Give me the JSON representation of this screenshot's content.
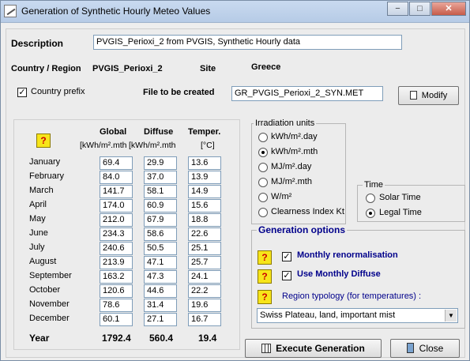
{
  "window": {
    "title": "Generation of Synthetic Hourly Meteo Values",
    "minimize": "−",
    "restore": "□",
    "close": "✕"
  },
  "description": {
    "label": "Description",
    "value": "PVGIS_Perioxi_2  from PVGIS, Synthetic Hourly data"
  },
  "location": {
    "country_region_label": "Country / Region",
    "country_region_value": "PVGIS_Perioxi_2",
    "site_label": "Site",
    "site_value": "Greece"
  },
  "country_prefix": {
    "label": "Country prefix",
    "checked": "✓"
  },
  "file": {
    "label": "File to be created",
    "value": "GR_PVGIS_Perioxi_2_SYN.MET",
    "modify_label": "Modify"
  },
  "table": {
    "year_header": "Year",
    "columns": [
      {
        "header": "Global",
        "unit": "[kWh/m².mth"
      },
      {
        "header": "Diffuse",
        "unit": "[kWh/m².mth"
      },
      {
        "header": "Temper.",
        "unit": "[°C]"
      }
    ],
    "rows": [
      {
        "month": "January",
        "global": "69.4",
        "diffuse": "29.9",
        "temp": "13.6"
      },
      {
        "month": "February",
        "global": "84.0",
        "diffuse": "37.0",
        "temp": "13.9"
      },
      {
        "month": "March",
        "global": "141.7",
        "diffuse": "58.1",
        "temp": "14.9"
      },
      {
        "month": "April",
        "global": "174.0",
        "diffuse": "60.9",
        "temp": "15.6"
      },
      {
        "month": "May",
        "global": "212.0",
        "diffuse": "67.9",
        "temp": "18.8"
      },
      {
        "month": "June",
        "global": "234.3",
        "diffuse": "58.6",
        "temp": "22.6"
      },
      {
        "month": "July",
        "global": "240.6",
        "diffuse": "50.5",
        "temp": "25.1"
      },
      {
        "month": "August",
        "global": "213.9",
        "diffuse": "47.1",
        "temp": "25.7"
      },
      {
        "month": "September",
        "global": "163.2",
        "diffuse": "47.3",
        "temp": "24.1"
      },
      {
        "month": "October",
        "global": "120.6",
        "diffuse": "44.6",
        "temp": "22.2"
      },
      {
        "month": "November",
        "global": "78.6",
        "diffuse": "31.4",
        "temp": "19.6"
      },
      {
        "month": "December",
        "global": "60.1",
        "diffuse": "27.1",
        "temp": "16.7"
      }
    ],
    "total": {
      "label": "Year",
      "global": "1792.4",
      "diffuse": "560.4",
      "temp": "19.4"
    }
  },
  "irradiation_units": {
    "title": "Irradiation units",
    "options": [
      "kWh/m².day",
      "kWh/m².mth",
      "MJ/m².day",
      "MJ/m².mth",
      "W/m²",
      "Clearness Index Kt"
    ],
    "selected": "kWh/m².mth"
  },
  "time": {
    "title": "Time",
    "options": [
      "Solar Time",
      "Legal Time"
    ],
    "selected": "Legal Time"
  },
  "generation_options": {
    "title": "Generation options",
    "monthly_renormalisation": "Monthly renormalisation",
    "use_monthly_diffuse": "Use Monthly Diffuse",
    "region_typology_label": "Region typology  (for temperatures) :",
    "region_typology_value": "Swiss Plateau, land, important mist"
  },
  "buttons": {
    "execute": "Execute Generation",
    "close": "Close"
  },
  "help_glyph": "?",
  "colors": {
    "accent": "#00008b",
    "titlebar": "#c9daf0"
  }
}
